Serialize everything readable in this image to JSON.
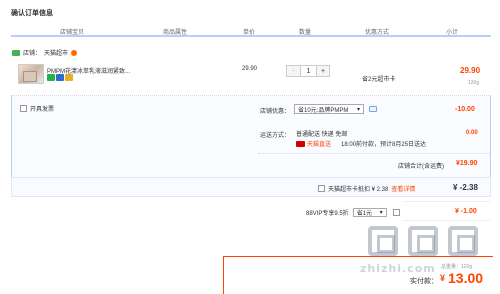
{
  "section_title": "确认订单信息",
  "headers": {
    "store_col": "店铺宝贝",
    "attr_col": "商品属性",
    "price_col": "单价",
    "qty_col": "数量",
    "promo_col": "优惠方式",
    "subtotal_col": "小计"
  },
  "store": {
    "label": "店铺：",
    "name": "天猫超市"
  },
  "item": {
    "name": "PMPM花漾冰萃乳液滋润紧致...",
    "unit_price": "29.90",
    "qty": "1",
    "minus": "-",
    "plus": "+",
    "promo": "省2元超市卡",
    "subtotal": "29.90",
    "weight": "120g"
  },
  "invoice": {
    "label": "开具发票"
  },
  "store_coupon": {
    "label": "店铺优惠：",
    "value": "省10元:品牌PMPM",
    "amount": "-10.00"
  },
  "shipping": {
    "label": "运送方式：",
    "method": "普通配送 快递 免邮",
    "carrier": "天猫直送",
    "eta": "18:00前付款，预计8月25日送达",
    "fee": "0.00"
  },
  "store_total": {
    "label": "店铺合计(含运费)",
    "amount": "¥19.90"
  },
  "supermarket_card": {
    "label": "天猫超市卡抵扣 ¥ 2.38",
    "link": "查看详情",
    "amount": "¥ -2.38"
  },
  "vip": {
    "label": "88VIP专享9.5折",
    "value": "省1元",
    "amount": "¥ -1.00"
  },
  "payment": {
    "weight_label": "总重量：",
    "weight": "120g",
    "label": "实付款：",
    "currency": "¥",
    "amount": "13.00"
  },
  "watermark": "zhizhi.com",
  "colors": {
    "accent": "#ff4400",
    "header_rule": "#b2d1ff",
    "panel_bg": "#fbfcff"
  }
}
